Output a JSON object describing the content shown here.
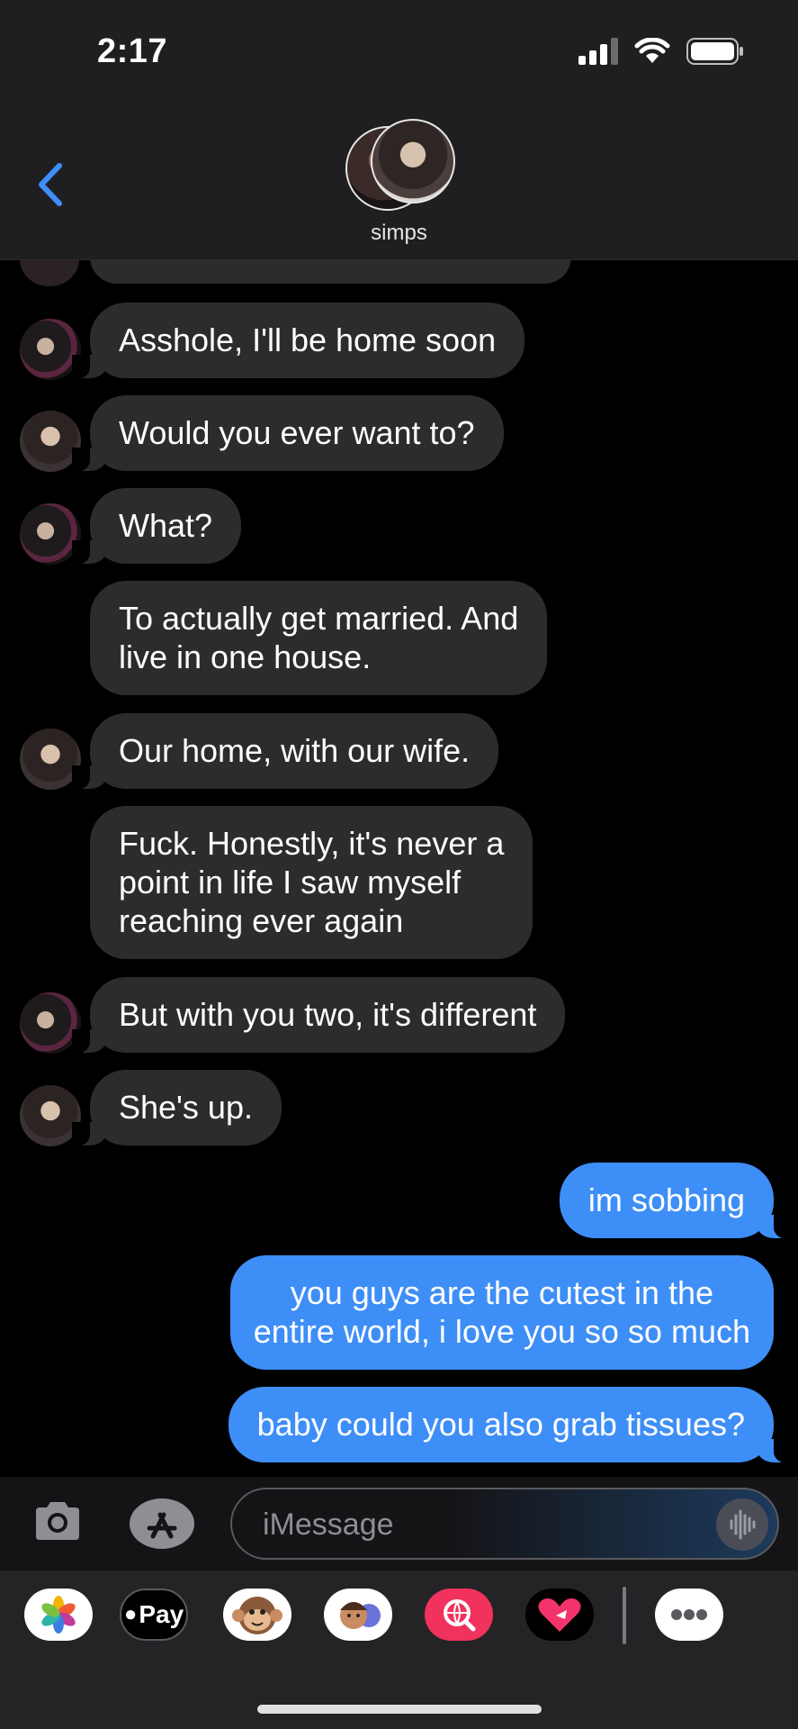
{
  "status_bar": {
    "time": "2:17"
  },
  "header": {
    "group_name": "simps"
  },
  "messages": [
    {
      "text": "Asshole, I'll be home soon",
      "from": "them"
    },
    {
      "text": "Would you ever want to?",
      "from": "them"
    },
    {
      "text": "What?",
      "from": "them"
    },
    {
      "text": "To actually get married. And\nlive in one house.",
      "from": "them"
    },
    {
      "text": "Our home, with our wife.",
      "from": "them"
    },
    {
      "text": "Fuck. Honestly, it's never a\npoint in life I saw myself\nreaching ever again",
      "from": "them"
    },
    {
      "text": "But with you two, it's different",
      "from": "them"
    },
    {
      "text": "She's up.",
      "from": "them"
    },
    {
      "text": "im sobbing",
      "from": "me"
    },
    {
      "text": " you guys are the cutest in the\nentire world, i love you so so much",
      "from": "me"
    },
    {
      "text": "baby could you also grab tissues?",
      "from": "me"
    }
  ],
  "input": {
    "placeholder": "iMessage"
  },
  "apps": [
    {
      "name": "photos-app-icon"
    },
    {
      "name": "apple-pay-app-icon",
      "label": "Pay"
    },
    {
      "name": "animoji-monkey-icon"
    },
    {
      "name": "memoji-icon"
    },
    {
      "name": "images-search-icon"
    },
    {
      "name": "digital-touch-icon"
    },
    {
      "name": "more-apps-icon"
    }
  ],
  "colors": {
    "bubble_them": "#2c2c2e",
    "bubble_me": "#3e8ef7",
    "accent": "#3e8ef7"
  }
}
